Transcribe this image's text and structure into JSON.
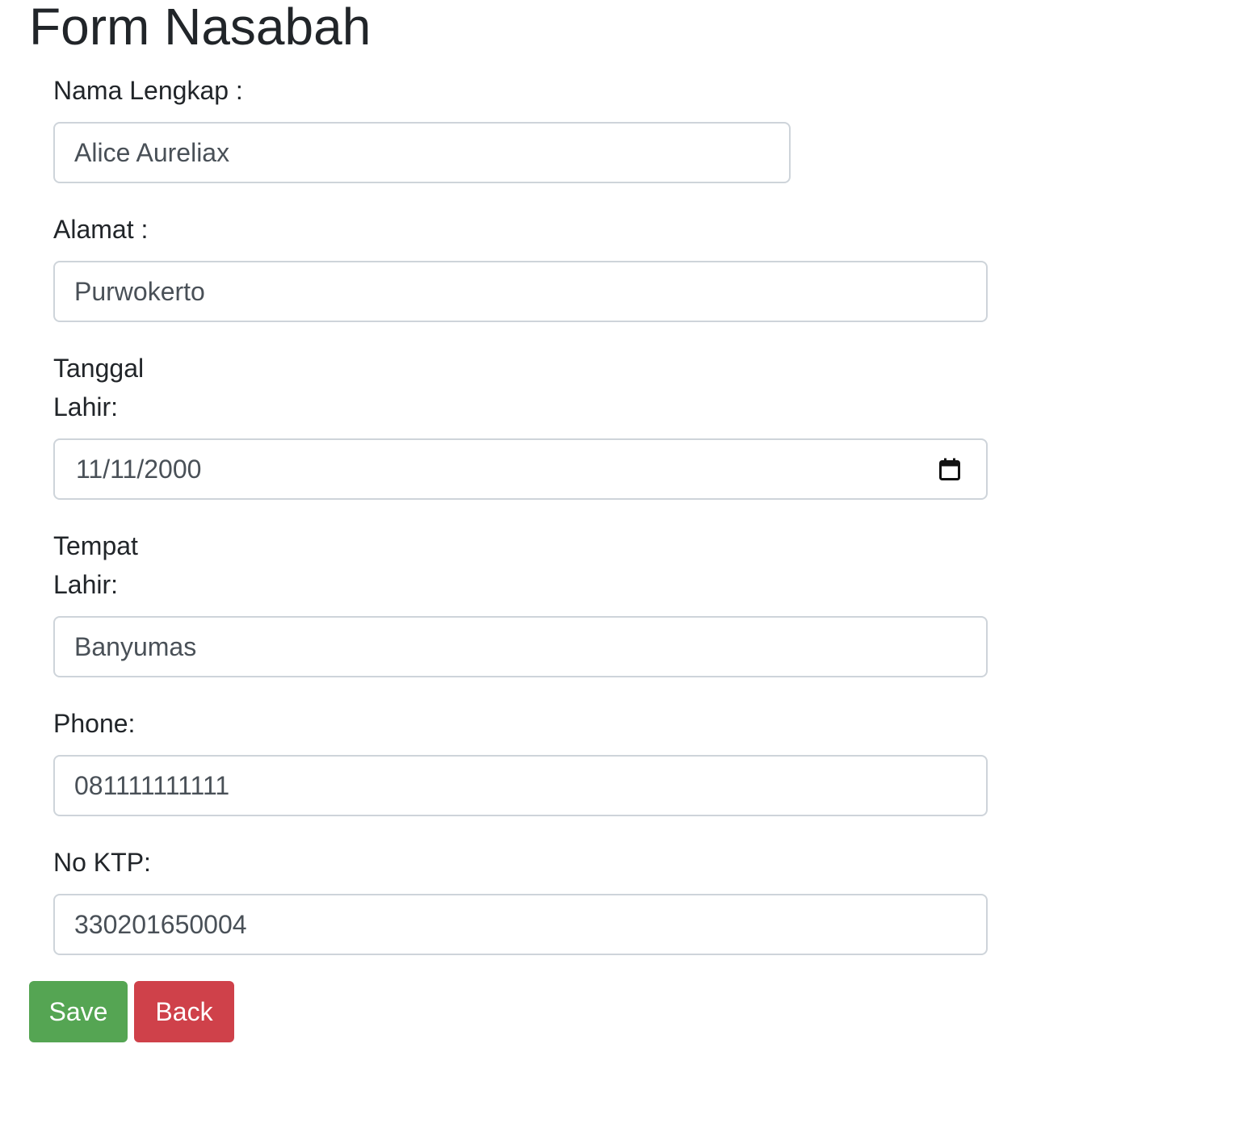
{
  "page": {
    "title": "Form Nasabah"
  },
  "form": {
    "nama_lengkap": {
      "label": "Nama Lengkap :",
      "value": "Alice Aureliax"
    },
    "alamat": {
      "label": "Alamat :",
      "value": "Purwokerto"
    },
    "tanggal_lahir": {
      "label_line1": "Tanggal",
      "label_line2": "Lahir:",
      "value": "11/11/2000",
      "icon": "calendar-icon"
    },
    "tempat_lahir": {
      "label_line1": "Tempat",
      "label_line2": "Lahir:",
      "value": "Banyumas"
    },
    "phone": {
      "label": "Phone:",
      "value": "081111111111"
    },
    "no_ktp": {
      "label": "No KTP:",
      "value": "330201650004"
    }
  },
  "actions": {
    "save_label": "Save",
    "back_label": "Back",
    "save_color": "#55a553",
    "back_color": "#cf414a"
  }
}
